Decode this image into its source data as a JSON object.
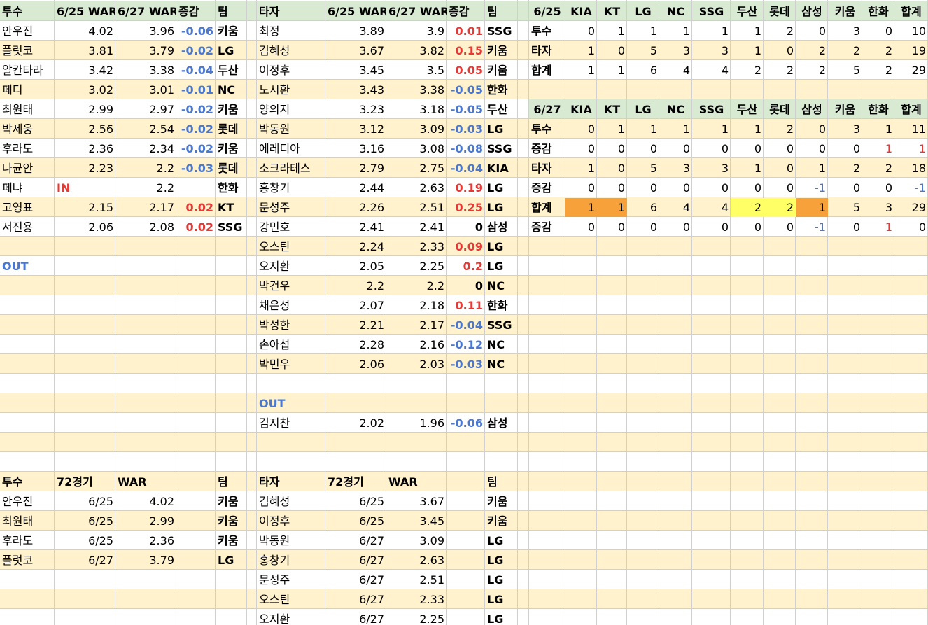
{
  "colors": {
    "header_green": "#d9ead3",
    "band_beige": "#fff2cc",
    "orange": "#f6a13a",
    "yellow": "#ffff66",
    "grid": "#d0d0d0",
    "red": "#e53935",
    "blue": "#4a78d0"
  },
  "top_header": {
    "pitchers": [
      "투수",
      "6/25 WAR",
      "6/27 WAR",
      "증감",
      "팀"
    ],
    "batters": [
      "타자",
      "6/25 WAR",
      "6/27 WAR",
      "증감",
      "팀"
    ],
    "teams": [
      "6/25",
      "KIA",
      "KT",
      "LG",
      "NC",
      "SSG",
      "두산",
      "롯데",
      "삼성",
      "키움",
      "한화",
      "합계"
    ]
  },
  "pitchers": [
    [
      "안우진",
      "4.02",
      "3.96",
      "-0.06",
      "키움"
    ],
    [
      "플럿코",
      "3.81",
      "3.79",
      "-0.02",
      "LG"
    ],
    [
      "알칸타라",
      "3.42",
      "3.38",
      "-0.04",
      "두산"
    ],
    [
      "페디",
      "3.02",
      "3.01",
      "-0.01",
      "NC"
    ],
    [
      "최원태",
      "2.99",
      "2.97",
      "-0.02",
      "키움"
    ],
    [
      "박세웅",
      "2.56",
      "2.54",
      "-0.02",
      "롯데"
    ],
    [
      "후라도",
      "2.36",
      "2.34",
      "-0.02",
      "키움"
    ],
    [
      "나균안",
      "2.23",
      "2.2",
      "-0.03",
      "롯데"
    ],
    [
      "페냐",
      "IN",
      "2.2",
      "",
      "한화"
    ],
    [
      "고영표",
      "2.15",
      "2.17",
      "0.02",
      "KT"
    ],
    [
      "서진용",
      "2.06",
      "2.08",
      "0.02",
      "SSG"
    ]
  ],
  "pitchers_out_label": "OUT",
  "batters": [
    [
      "최정",
      "3.89",
      "3.9",
      "0.01",
      "SSG"
    ],
    [
      "김혜성",
      "3.67",
      "3.82",
      "0.15",
      "키움"
    ],
    [
      "이정후",
      "3.45",
      "3.5",
      "0.05",
      "키움"
    ],
    [
      "노시환",
      "3.43",
      "3.38",
      "-0.05",
      "한화"
    ],
    [
      "양의지",
      "3.23",
      "3.18",
      "-0.05",
      "두산"
    ],
    [
      "박동원",
      "3.12",
      "3.09",
      "-0.03",
      "LG"
    ],
    [
      "에레디아",
      "3.16",
      "3.08",
      "-0.08",
      "SSG"
    ],
    [
      "소크라테스",
      "2.79",
      "2.75",
      "-0.04",
      "KIA"
    ],
    [
      "홍창기",
      "2.44",
      "2.63",
      "0.19",
      "LG"
    ],
    [
      "문성주",
      "2.26",
      "2.51",
      "0.25",
      "LG"
    ],
    [
      "강민호",
      "2.41",
      "2.41",
      "0",
      "삼성"
    ],
    [
      "오스틴",
      "2.24",
      "2.33",
      "0.09",
      "LG"
    ],
    [
      "오지환",
      "2.05",
      "2.25",
      "0.2",
      "LG"
    ],
    [
      "박건우",
      "2.2",
      "2.2",
      "0",
      "NC"
    ],
    [
      "채은성",
      "2.07",
      "2.18",
      "0.11",
      "한화"
    ],
    [
      "박성한",
      "2.21",
      "2.17",
      "-0.04",
      "SSG"
    ],
    [
      "손아섭",
      "2.28",
      "2.16",
      "-0.12",
      "NC"
    ],
    [
      "박민우",
      "2.06",
      "2.03",
      "-0.03",
      "NC"
    ]
  ],
  "batters_out_label": "OUT",
  "batters_out": [
    [
      "김지찬",
      "2.02",
      "1.96",
      "-0.06",
      "삼성"
    ]
  ],
  "teams_625": [
    [
      "투수",
      "0",
      "1",
      "1",
      "1",
      "1",
      "1",
      "2",
      "0",
      "3",
      "0",
      "10"
    ],
    [
      "타자",
      "1",
      "0",
      "5",
      "3",
      "3",
      "1",
      "0",
      "2",
      "2",
      "2",
      "19"
    ],
    [
      "합계",
      "1",
      "1",
      "6",
      "4",
      "4",
      "2",
      "2",
      "2",
      "5",
      "2",
      "29"
    ]
  ],
  "teams_627_header": [
    "6/27",
    "KIA",
    "KT",
    "LG",
    "NC",
    "SSG",
    "두산",
    "롯데",
    "삼성",
    "키움",
    "한화",
    "합계"
  ],
  "teams_627": [
    [
      "투수",
      "0",
      "1",
      "1",
      "1",
      "1",
      "1",
      "2",
      "0",
      "3",
      "1",
      "11"
    ],
    [
      "증감",
      "0",
      "0",
      "0",
      "0",
      "0",
      "0",
      "0",
      "0",
      "0",
      "1",
      "1"
    ],
    [
      "타자",
      "1",
      "0",
      "5",
      "3",
      "3",
      "1",
      "0",
      "1",
      "2",
      "2",
      "18"
    ],
    [
      "증감",
      "0",
      "0",
      "0",
      "0",
      "0",
      "0",
      "0",
      "-1",
      "0",
      "0",
      "-1"
    ],
    [
      "합계",
      "1",
      "1",
      "6",
      "4",
      "4",
      "2",
      "2",
      "1",
      "5",
      "3",
      "29"
    ],
    [
      "증감",
      "0",
      "0",
      "0",
      "0",
      "0",
      "0",
      "0",
      "-1",
      "0",
      "1",
      "0"
    ]
  ],
  "bottom_header": {
    "pitchers": [
      "투수",
      "72경기",
      "WAR",
      "",
      "팀"
    ],
    "batters": [
      "타자",
      "72경기",
      "WAR",
      "",
      "팀"
    ]
  },
  "bottom_pitchers": [
    [
      "안우진",
      "6/25",
      "4.02",
      "키움"
    ],
    [
      "최원태",
      "6/25",
      "2.99",
      "키움"
    ],
    [
      "후라도",
      "6/25",
      "2.36",
      "키움"
    ],
    [
      "플럿코",
      "6/27",
      "3.79",
      "LG"
    ]
  ],
  "bottom_batters": [
    [
      "김혜성",
      "6/25",
      "3.67",
      "키움"
    ],
    [
      "이정후",
      "6/25",
      "3.45",
      "키움"
    ],
    [
      "박동원",
      "6/27",
      "3.09",
      "LG"
    ],
    [
      "홍창기",
      "6/27",
      "2.63",
      "LG"
    ],
    [
      "문성주",
      "6/27",
      "2.51",
      "LG"
    ],
    [
      "오스틴",
      "6/27",
      "2.33",
      "LG"
    ],
    [
      "오지환",
      "6/27",
      "2.25",
      "LG"
    ]
  ]
}
